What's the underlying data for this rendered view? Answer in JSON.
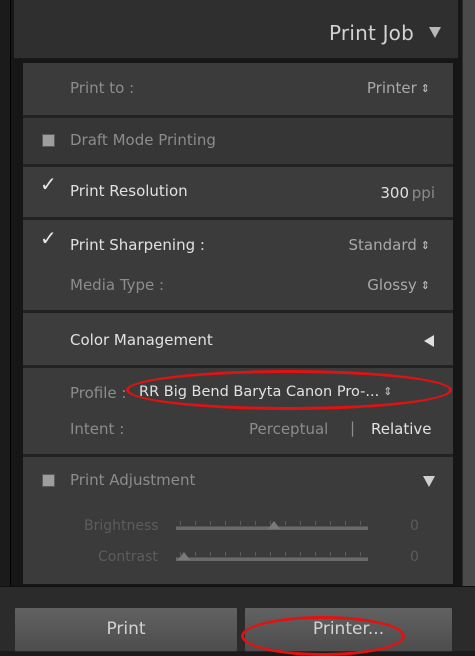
{
  "header": {
    "title": "Print Job"
  },
  "print_to": {
    "label": "Print to :",
    "value": "Printer"
  },
  "draft_mode": {
    "label": "Draft Mode Printing",
    "checked": false
  },
  "print_resolution": {
    "label": "Print Resolution",
    "value": "300",
    "unit": "ppi",
    "checked": true
  },
  "print_sharpening": {
    "label": "Print Sharpening :",
    "value": "Standard",
    "checked": true
  },
  "media_type": {
    "label": "Media Type :",
    "value": "Glossy"
  },
  "color_management": {
    "label": "Color Management"
  },
  "profile": {
    "label": "Profile :",
    "value": "RR Big Bend Baryta Canon Pro-..."
  },
  "intent": {
    "label": "Intent :",
    "options": [
      "Perceptual",
      "Relative"
    ],
    "selected": "Relative",
    "separator": "|"
  },
  "print_adjustment": {
    "label": "Print Adjustment",
    "checked": false
  },
  "brightness": {
    "label": "Brightness",
    "value": "0"
  },
  "contrast": {
    "label": "Contrast",
    "value": "0"
  },
  "buttons": {
    "print": "Print",
    "printer": "Printer..."
  },
  "colors": {
    "annotation": "#e21212",
    "panel": "#3b3b3b"
  }
}
